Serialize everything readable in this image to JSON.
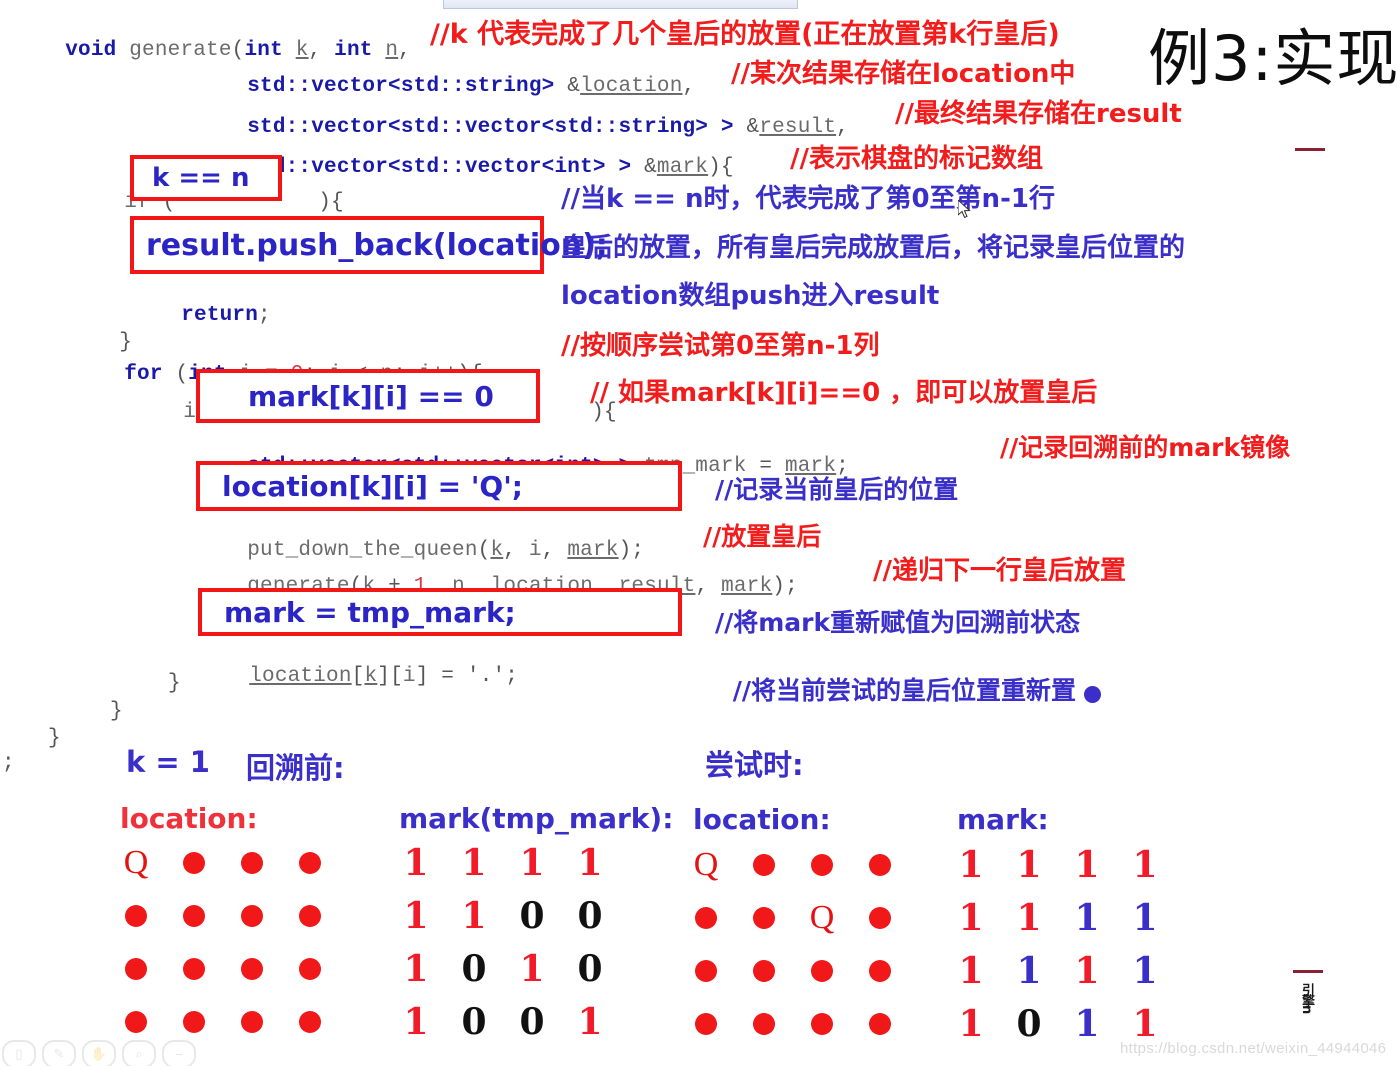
{
  "slide": {
    "title": "例3:实现",
    "watermark": "https://blog.csdn.net/weixin_44944046",
    "vertical_note": "引擎n"
  },
  "code": {
    "lines": [
      {
        "id": "l1",
        "text": "void generate(int k, int n,"
      },
      {
        "id": "l2",
        "text": "std::vector<std::string> &location,"
      },
      {
        "id": "l3",
        "text": "std::vector<std::vector<std::string> > &result,"
      },
      {
        "id": "l4",
        "text": "std::vector<std::vector<int> > &mark){"
      },
      {
        "id": "l5",
        "text": "if ("
      },
      {
        "id": "l5b",
        "text": "){"
      },
      {
        "id": "l6",
        "text": "return;"
      },
      {
        "id": "l7",
        "text": "}"
      },
      {
        "id": "l8",
        "text": "for (int i = 0; i < n; i++){"
      },
      {
        "id": "l9",
        "text": "if ("
      },
      {
        "id": "l9b",
        "text": "){"
      },
      {
        "id": "l10",
        "text": "std::vector<std::vector<int> > tmp_mark = mark;"
      },
      {
        "id": "l11",
        "text": "put_down_the_queen(k, i, mark);"
      },
      {
        "id": "l12",
        "text": "generate(k + 1, n, location, result, mark);"
      },
      {
        "id": "l13",
        "text": "location[k][i] = '.';"
      },
      {
        "id": "l14",
        "text": "}"
      },
      {
        "id": "l15",
        "text": "}"
      },
      {
        "id": "l16",
        "text": "}"
      },
      {
        "id": "l17",
        "text": ";"
      }
    ]
  },
  "boxes": {
    "k_eq_n": "k == n",
    "push_back": "result.push_back(location);",
    "mark_zero": "mark[k][i] == 0",
    "location_q": "location[k][i] = 'Q';",
    "mark_restore": "mark = tmp_mark;"
  },
  "comments": {
    "c1": "//k 代表完成了几个皇后的放置(正在放置第k行皇后)",
    "c2": "//某次结果存储在location中",
    "c3": "//最终结果存储在result",
    "c4": "//表示棋盘的标记数组",
    "c5": "//当k == n时，代表完成了第0至第n-1行",
    "c6": "皇后的放置，所有皇后完成放置后，将记录皇后位置的",
    "c7": "location数组push进入result",
    "c8": "//按顺序尝试第0至第n-1列",
    "c9": "// 如果mark[k][i]==0 ，即可以放置皇后",
    "c10": "//记录回溯前的mark镜像",
    "c11": "//记录当前皇后的位置",
    "c12": "//放置皇后",
    "c13": "//递归下一行皇后放置",
    "c14": "//将mark重新赋值为回溯前状态",
    "c15": "//将当前尝试的皇后位置重新置"
  },
  "diagram": {
    "k_label": "k = 1",
    "state_before": "回溯前:",
    "state_trying": "尝试时:",
    "grids": [
      {
        "name": "location-before",
        "label": "location:",
        "label_color": "#f0303a",
        "kind": "board",
        "rows": [
          [
            "Q",
            ".",
            ".",
            "."
          ],
          [
            ".",
            ".",
            ".",
            "."
          ],
          [
            ".",
            ".",
            ".",
            "."
          ],
          [
            ".",
            ".",
            ".",
            "."
          ]
        ]
      },
      {
        "name": "mark-before",
        "label": "mark(tmp_mark):",
        "label_color": "#3a2fc8",
        "kind": "matrix",
        "rows": [
          [
            "1",
            "1",
            "1",
            "1"
          ],
          [
            "1",
            "1",
            "0",
            "0"
          ],
          [
            "1",
            "0",
            "1",
            "0"
          ],
          [
            "1",
            "0",
            "0",
            "1"
          ]
        ],
        "colors": [
          [
            "red",
            "red",
            "red",
            "red"
          ],
          [
            "red",
            "red",
            "black",
            "black"
          ],
          [
            "red",
            "black",
            "red",
            "black"
          ],
          [
            "red",
            "black",
            "black",
            "red"
          ]
        ]
      },
      {
        "name": "location-trying",
        "label": "location:",
        "label_color": "#3a2fc8",
        "kind": "board",
        "rows": [
          [
            "Q",
            ".",
            ".",
            "."
          ],
          [
            ".",
            ".",
            "Q",
            "."
          ],
          [
            ".",
            ".",
            ".",
            "."
          ],
          [
            ".",
            ".",
            ".",
            "."
          ]
        ]
      },
      {
        "name": "mark-trying",
        "label": "mark:",
        "label_color": "#3a2fc8",
        "kind": "matrix",
        "rows": [
          [
            "1",
            "1",
            "1",
            "1"
          ],
          [
            "1",
            "1",
            "1",
            "1"
          ],
          [
            "1",
            "1",
            "1",
            "1"
          ],
          [
            "1",
            "0",
            "1",
            "1"
          ]
        ],
        "colors": [
          [
            "red",
            "red",
            "red",
            "red"
          ],
          [
            "red",
            "red",
            "blue",
            "blue"
          ],
          [
            "red",
            "blue",
            "red",
            "blue"
          ],
          [
            "red",
            "black",
            "blue",
            "red"
          ]
        ]
      }
    ]
  },
  "toolbar": {
    "icons": [
      "book-icon",
      "pen-icon",
      "hand-icon",
      "zoom-icon",
      "minus-icon"
    ]
  }
}
